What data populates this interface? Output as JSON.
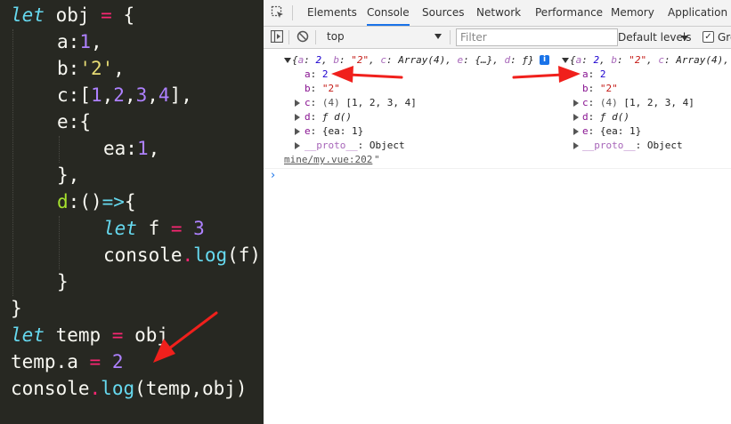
{
  "editor": {
    "l1": {
      "kw": "let",
      "name": " obj ",
      "eq": "=",
      "brace": " {"
    },
    "l2": {
      "key": "a",
      "colon": ":",
      "val": "1",
      "comma": ","
    },
    "l3": {
      "key": "b",
      "colon": ":",
      "val": "'2'",
      "comma": ","
    },
    "l4": {
      "key": "c",
      "colon": ":",
      "open": "[",
      "n1": "1",
      "c1": ",",
      "n2": "2",
      "c2": ",",
      "n3": "3",
      "c3": ",",
      "n4": "4",
      "close": "]",
      "comma": ","
    },
    "l5": {
      "key": "e",
      "colon": ":",
      "brace": "{"
    },
    "l6": {
      "key": "ea",
      "colon": ":",
      "val": "1",
      "comma": ","
    },
    "l7": {
      "text": "},"
    },
    "l8": {
      "key": "d",
      "colon": ":",
      "paren": "()",
      "arrow": "=>",
      "brace": "{"
    },
    "l9": {
      "kw": "let",
      "name": " f ",
      "eq": "=",
      "val": " 3"
    },
    "l10": {
      "obj": "console",
      "dot": ".",
      "meth": "log",
      "args": "(f)"
    },
    "l11": {
      "text": "}"
    },
    "l12": {
      "text": "}"
    },
    "l13": {
      "kw": "let",
      "name": " temp ",
      "eq": "=",
      "rest": " obj"
    },
    "l14": {
      "obj": "temp.a ",
      "eq": "=",
      "val": " 2"
    },
    "l15": {
      "obj": "console",
      "dot": ".",
      "meth": "log",
      "args": "(temp,obj)"
    }
  },
  "devtools": {
    "tabs": [
      "Elements",
      "Console",
      "Sources",
      "Network",
      "Performance",
      "Memory",
      "Application"
    ],
    "active_tab": "Console",
    "context": "top",
    "filter_placeholder": "Filter",
    "levels_label": "Default levels",
    "group_label": "Gro",
    "group_checked_mark": "✓"
  },
  "console": {
    "left": {
      "summary": {
        "o": "{",
        "a_k": "a",
        "a_sep": ": ",
        "a_v": "2",
        "s1": ", ",
        "b_k": "b",
        "b_sep": ": ",
        "b_v": "\"2\"",
        "s2": ", ",
        "c_k": "c",
        "c_sep": ": ",
        "c_v": "Array(4)",
        "s3": ", ",
        "e_k": "e",
        "e_sep": ": ",
        "e_v": "{…}",
        "s4": ", ",
        "d_k": "d",
        "d_sep": ": ",
        "d_v": "ƒ",
        "close": "}"
      },
      "info": "i",
      "a": {
        "k": "a",
        "sep": ": ",
        "v": "2"
      },
      "b": {
        "k": "b",
        "sep": ": ",
        "v": "\"2\""
      },
      "c": {
        "k": "c",
        "sep": ": ",
        "pre": "(4) ",
        "v": "[1, 2, 3, 4]"
      },
      "d": {
        "k": "d",
        "sep": ": ",
        "v": "ƒ d()"
      },
      "e": {
        "k": "e",
        "sep": ": ",
        "v": "{ea: 1}"
      },
      "proto": {
        "k": "__proto__",
        "sep": ": ",
        "v": "Object"
      }
    },
    "right": {
      "summary": {
        "o": "{",
        "a_k": "a",
        "a_sep": ": ",
        "a_v": "2",
        "s1": ", ",
        "b_k": "b",
        "b_sep": ": ",
        "b_v": "\"2\"",
        "s2": ", ",
        "c_k": "c",
        "c_sep": ": ",
        "c_v": "Array(4),"
      },
      "a": {
        "k": "a",
        "sep": ": ",
        "v": "2"
      },
      "b": {
        "k": "b",
        "sep": ": ",
        "v": "\"2\""
      },
      "c": {
        "k": "c",
        "sep": ": ",
        "pre": "(4) ",
        "v": "[1, 2, 3, 4]"
      },
      "d": {
        "k": "d",
        "sep": ": ",
        "v": "ƒ d()"
      },
      "e": {
        "k": "e",
        "sep": ": ",
        "v": "{ea: 1}"
      },
      "proto": {
        "k": "__proto__",
        "sep": ": ",
        "v": "Object"
      }
    },
    "source": "mine/my.vue:202",
    "source_tail": "\"",
    "prompt": "›"
  },
  "colors": {
    "editor_bg": "#272822",
    "arrow_red": "#f0201c",
    "accent": "#1a73e8"
  }
}
